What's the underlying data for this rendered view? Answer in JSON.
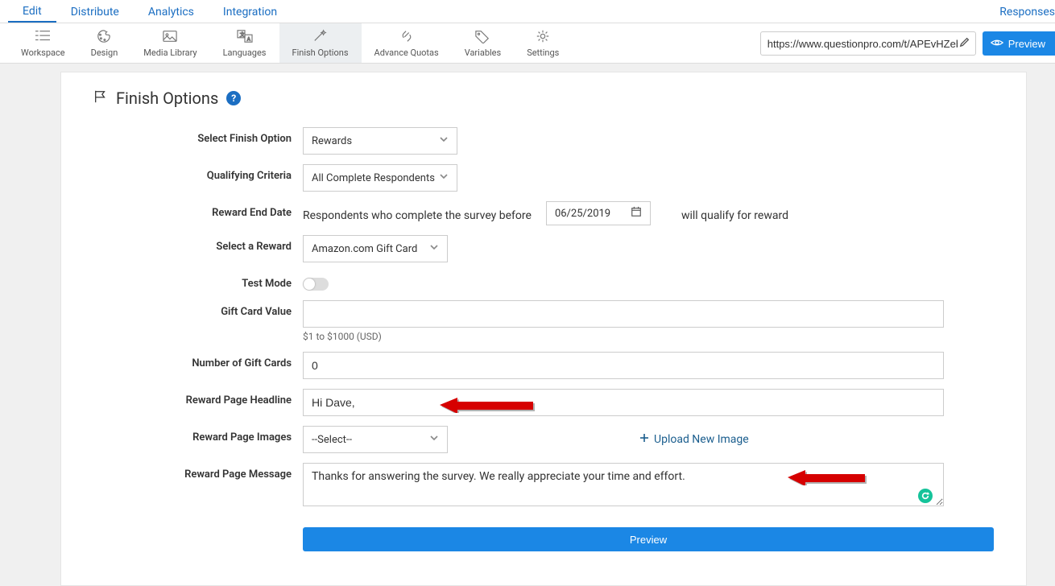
{
  "nav": {
    "tabs": [
      "Edit",
      "Distribute",
      "Analytics",
      "Integration"
    ],
    "responses": "Responses"
  },
  "toolbar": {
    "items": [
      {
        "label": "Workspace"
      },
      {
        "label": "Design"
      },
      {
        "label": "Media Library"
      },
      {
        "label": "Languages"
      },
      {
        "label": "Finish Options"
      },
      {
        "label": "Advance Quotas"
      },
      {
        "label": "Variables"
      },
      {
        "label": "Settings"
      }
    ],
    "url": "https://www.questionpro.com/t/APEvHZeb",
    "preview_btn": "Preview"
  },
  "page": {
    "title": "Finish Options",
    "form": {
      "finish_option_label": "Select Finish Option",
      "finish_option_value": "Rewards",
      "criteria_label": "Qualifying Criteria",
      "criteria_value": "All Complete Respondents",
      "end_date_label": "Reward End Date",
      "end_date_before": "Respondents who complete the survey before",
      "end_date_value": "06/25/2019",
      "end_date_after": "will qualify for reward",
      "select_reward_label": "Select a Reward",
      "select_reward_value": "Amazon.com Gift Card",
      "test_mode_label": "Test Mode",
      "gift_value_label": "Gift Card Value",
      "gift_value_value": "",
      "gift_value_help": "$1 to $1000 (USD)",
      "num_cards_label": "Number of Gift Cards",
      "num_cards_value": "0",
      "headline_label": "Reward Page Headline",
      "headline_value": "Hi Dave,",
      "images_label": "Reward Page Images",
      "images_value": "--Select--",
      "upload_link": "Upload New Image",
      "message_label": "Reward Page Message",
      "message_value": "Thanks for answering the survey. We really appreciate your time and effort.",
      "preview_btn": "Preview"
    }
  }
}
